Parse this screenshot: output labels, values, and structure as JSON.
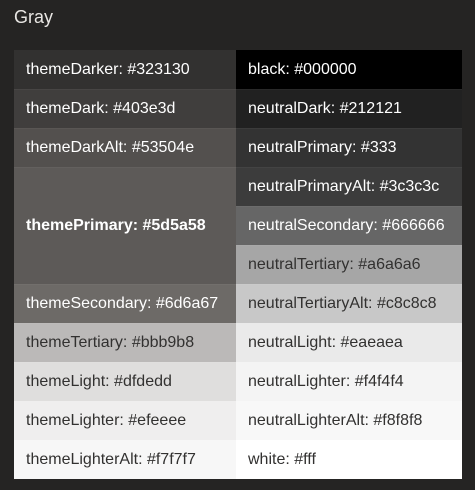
{
  "section": {
    "title": "Gray"
  },
  "theme_swatches": [
    {
      "label": "themeDarker: #323130",
      "bg": "#323130",
      "fg": "#ffffff"
    },
    {
      "label": "themeDark: #403e3d",
      "bg": "#403e3d",
      "fg": "#ffffff"
    },
    {
      "label": "themeDarkAlt: #53504e",
      "bg": "#53504e",
      "fg": "#ffffff"
    },
    {
      "label": "themePrimary: #5d5a58",
      "bg": "#5d5a58",
      "fg": "#ffffff"
    },
    {
      "label": "themeSecondary: #6d6a67",
      "bg": "#6d6a67",
      "fg": "#ffffff"
    },
    {
      "label": "themeTertiary: #bbb9b8",
      "bg": "#bbb9b8",
      "fg": "#323130"
    },
    {
      "label": "themeLight: #dfdedd",
      "bg": "#dfdedd",
      "fg": "#323130"
    },
    {
      "label": "themeLighter: #efeeee",
      "bg": "#efeeee",
      "fg": "#323130"
    },
    {
      "label": "themeLighterAlt: #f7f7f7",
      "bg": "#f7f7f7",
      "fg": "#323130"
    }
  ],
  "neutral_swatches": [
    {
      "label": "black: #000000",
      "bg": "#000000",
      "fg": "#ffffff"
    },
    {
      "label": "neutralDark: #212121",
      "bg": "#212121",
      "fg": "#ffffff"
    },
    {
      "label": "neutralPrimary: #333",
      "bg": "#333333",
      "fg": "#ffffff"
    },
    {
      "label": "neutralPrimaryAlt: #3c3c3c",
      "bg": "#3c3c3c",
      "fg": "#ffffff"
    },
    {
      "label": "neutralSecondary: #666666",
      "bg": "#666666",
      "fg": "#ffffff"
    },
    {
      "label": "neutralTertiary: #a6a6a6",
      "bg": "#a6a6a6",
      "fg": "#323130"
    },
    {
      "label": "neutralTertiaryAlt: #c8c8c8",
      "bg": "#c8c8c8",
      "fg": "#323130"
    },
    {
      "label": "neutralLight: #eaeaea",
      "bg": "#eaeaea",
      "fg": "#323130"
    },
    {
      "label": "neutralLighter: #f4f4f4",
      "bg": "#f4f4f4",
      "fg": "#323130"
    },
    {
      "label": "neutralLighterAlt: #f8f8f8",
      "bg": "#f8f8f8",
      "fg": "#323130"
    },
    {
      "label": "white: #fff",
      "bg": "#ffffff",
      "fg": "#323130"
    }
  ]
}
